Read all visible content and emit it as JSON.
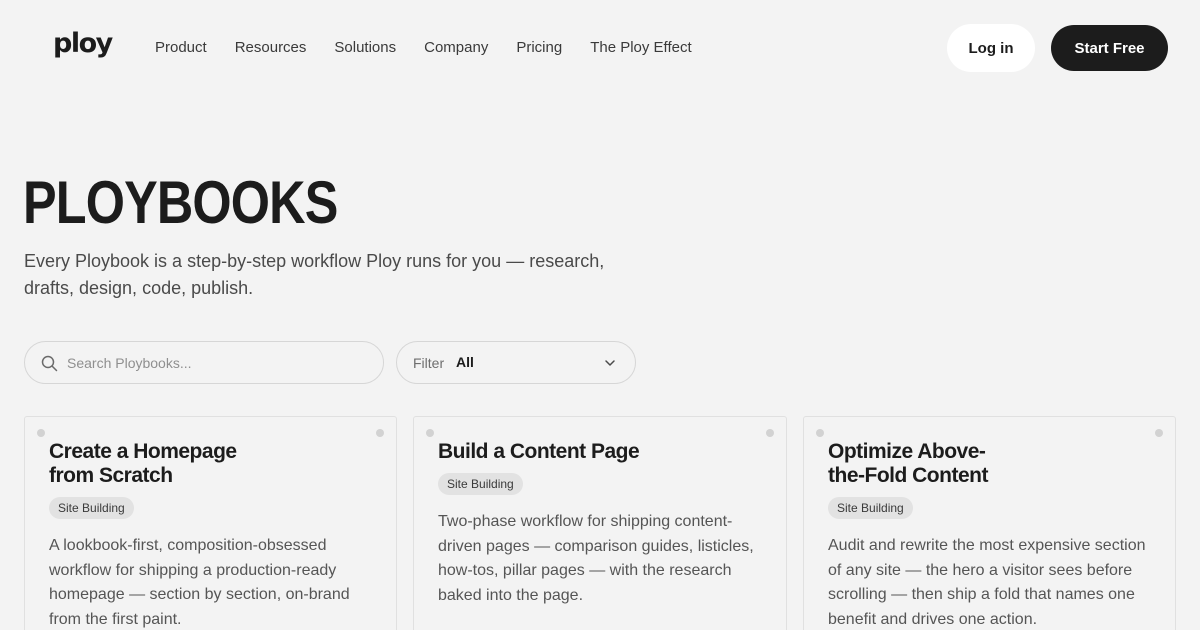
{
  "header": {
    "logo": "ploy",
    "nav": [
      "Product",
      "Resources",
      "Solutions",
      "Company",
      "Pricing",
      "The Ploy Effect"
    ],
    "login_label": "Log in",
    "start_label": "Start Free"
  },
  "hero": {
    "title": "PLOYBOOKS",
    "subtitle": "Every Ploybook is a step-by-step workflow Ploy runs for you — research, drafts, design, code, publish."
  },
  "search": {
    "placeholder": "Search Ploybooks...",
    "value": ""
  },
  "filter": {
    "label": "Filter",
    "value": "All"
  },
  "cards": [
    {
      "title_lines": [
        "Create a Homepage",
        "from Scratch"
      ],
      "tag": "Site Building",
      "description": "A lookbook-first, composition-obsessed workflow for shipping a production-ready homepage — section by section, on-brand from the first paint."
    },
    {
      "title_lines": [
        "Build a Content Page"
      ],
      "tag": "Site Building",
      "description": "Two-phase workflow for shipping content-driven pages — comparison guides, listicles, how-tos, pillar pages — with the research baked into the page."
    },
    {
      "title_lines": [
        "Optimize Above-",
        "the-Fold Content"
      ],
      "tag": "Site Building",
      "description": "Audit and rewrite the most expensive section of any site — the hero a visitor sees before scrolling — then ship a fold that names one benefit and drives one action."
    }
  ],
  "colors": {
    "background": "#f3f3f3",
    "primary_button": "#1c1c1c",
    "badge": "#e2e2e2"
  },
  "icons": {
    "search": "search-icon",
    "filter": "chevron-down-icon"
  }
}
